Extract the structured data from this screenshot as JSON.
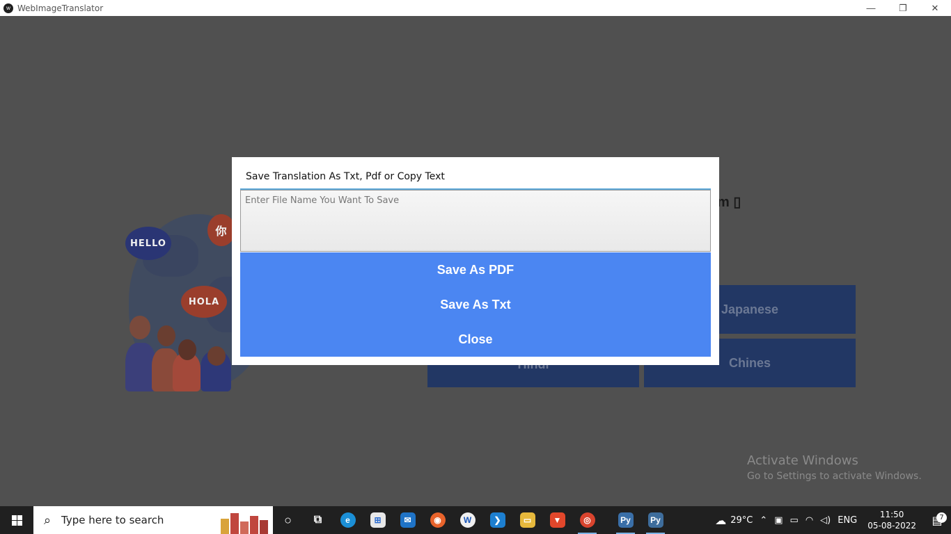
{
  "window": {
    "title": "WebImageTranslator",
    "controls": {
      "minimize": "—",
      "restore": "❐",
      "close": "✕"
    }
  },
  "background": {
    "heading_fragment": "m ▯",
    "bubbles": {
      "hello": "HELLO",
      "hola": "HOLA",
      "chinese": "你"
    },
    "language_buttons": [
      "Japanese",
      "Hindi",
      "Chines"
    ]
  },
  "dialog": {
    "title": "Save Translation As Txt, Pdf or Copy Text",
    "input_placeholder": "Enter File Name You Want To Save",
    "input_value": "",
    "buttons": [
      "Save As PDF",
      "Save As Txt",
      "Close"
    ],
    "accent_color": "#4b86f2"
  },
  "watermark": {
    "line1": "Activate Windows",
    "line2": "Go to Settings to activate Windows."
  },
  "taskbar": {
    "search_placeholder": "Type here to search",
    "weather": "29°C",
    "language": "ENG",
    "time": "11:50",
    "date": "05-08-2022",
    "notification_count": "7",
    "apps": [
      {
        "name": "cortana-icon",
        "glyph": "○"
      },
      {
        "name": "task-view-icon",
        "glyph": "⧉"
      },
      {
        "name": "edge-icon",
        "glyph": "e"
      },
      {
        "name": "store-icon",
        "glyph": "⊞"
      },
      {
        "name": "mail-icon",
        "glyph": "✉"
      },
      {
        "name": "firefox-icon",
        "glyph": "◉"
      },
      {
        "name": "wordpad-icon",
        "glyph": "W"
      },
      {
        "name": "vscode-icon",
        "glyph": "❯"
      },
      {
        "name": "file-explorer-icon",
        "glyph": "▭"
      },
      {
        "name": "brave-icon",
        "glyph": "▼"
      },
      {
        "name": "chrome-icon",
        "glyph": "◎"
      },
      {
        "name": "python-idle-icon",
        "glyph": "Py"
      },
      {
        "name": "python-app-icon",
        "glyph": "Py"
      }
    ]
  }
}
